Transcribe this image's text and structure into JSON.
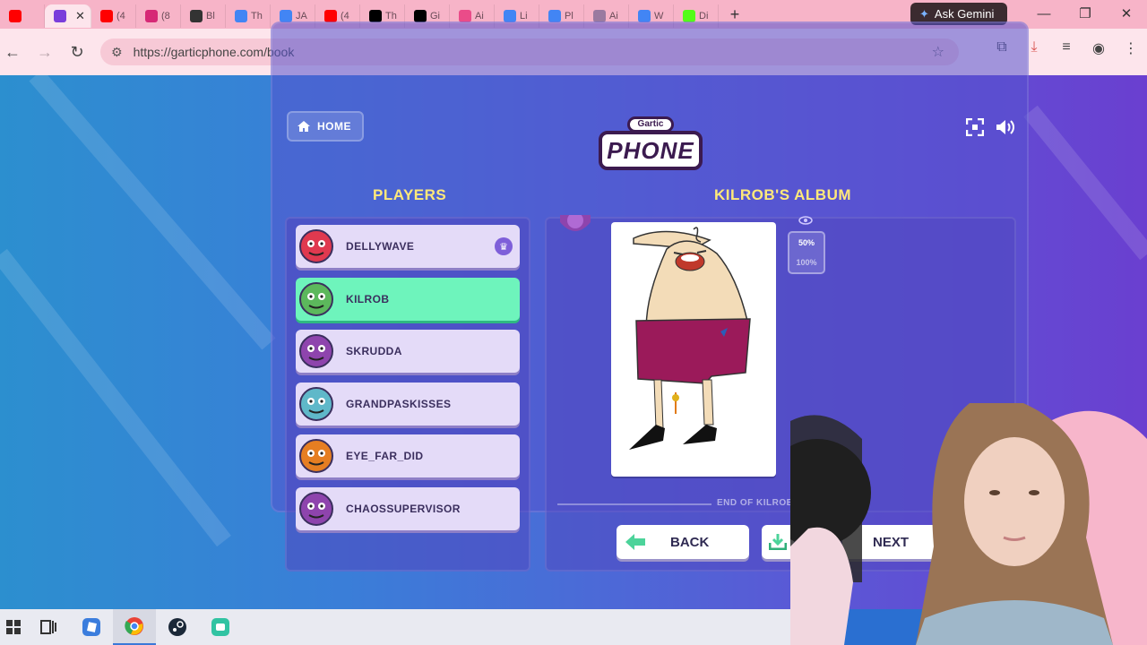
{
  "browser": {
    "tabs": [
      {
        "label": "",
        "icon": "youtube-audio-icon",
        "color": "#ff0000"
      },
      {
        "label": "",
        "icon": "garticphone-icon",
        "color": "#7a3ddb",
        "active": true
      },
      {
        "label": "(4",
        "icon": "youtube-icon",
        "color": "#ff0000"
      },
      {
        "label": "(8",
        "icon": "instagram-icon",
        "color": "#d62976"
      },
      {
        "label": "Bl",
        "icon": "spy-icon",
        "color": "#333333"
      },
      {
        "label": "Th",
        "icon": "google-icon",
        "color": "#4285f4"
      },
      {
        "label": "JA",
        "icon": "google-icon",
        "color": "#4285f4"
      },
      {
        "label": "(4",
        "icon": "youtube-icon",
        "color": "#ff0000"
      },
      {
        "label": "Th",
        "icon": "x-icon",
        "color": "#000000"
      },
      {
        "label": "Gi",
        "icon": "x-icon",
        "color": "#000000"
      },
      {
        "label": "Ai",
        "icon": "dribbble-icon",
        "color": "#ea4c89"
      },
      {
        "label": "Li",
        "icon": "google-icon",
        "color": "#4285f4"
      },
      {
        "label": "Pl",
        "icon": "google-icon",
        "color": "#4285f4"
      },
      {
        "label": "Ai",
        "icon": "briefcase-icon",
        "color": "#9a7aa0"
      },
      {
        "label": "W",
        "icon": "google-icon",
        "color": "#4285f4"
      },
      {
        "label": "Di",
        "icon": "kick-icon",
        "color": "#53fc18"
      }
    ],
    "gemini_label": "Ask Gemini",
    "url": "https://garticphone.com/book"
  },
  "game": {
    "home_label": "HOME",
    "logo_small": "Gartic",
    "logo_big": "PHONE",
    "players_heading": "PLAYERS",
    "album_heading": "KILROB'S ALBUM",
    "players": [
      {
        "name": "DELLYWAVE",
        "host": true,
        "avatar_color": "#e0394f",
        "active": false
      },
      {
        "name": "KILROB",
        "host": false,
        "avatar_color": "#5cb85c",
        "active": true
      },
      {
        "name": "SKRUDDA",
        "host": false,
        "avatar_color": "#8e44ad",
        "active": false
      },
      {
        "name": "GRANDPASKISSES",
        "host": false,
        "avatar_color": "#5fb8c9",
        "active": false
      },
      {
        "name": "EYE_FAR_DID",
        "host": false,
        "avatar_color": "#e67e22",
        "active": false
      },
      {
        "name": "CHAOSSUPERVISOR",
        "host": false,
        "avatar_color": "#8e44ad",
        "active": false
      }
    ],
    "zoom_options": [
      "50%",
      "100%"
    ],
    "zoom_selected": "50%",
    "end_text": "END OF KILROB",
    "back_label": "BACK",
    "next_label": "NEXT"
  },
  "colors": {
    "heading": "#ffe97a",
    "active_player": "#6ef4bc",
    "player_bg": "#e4dbf8"
  }
}
